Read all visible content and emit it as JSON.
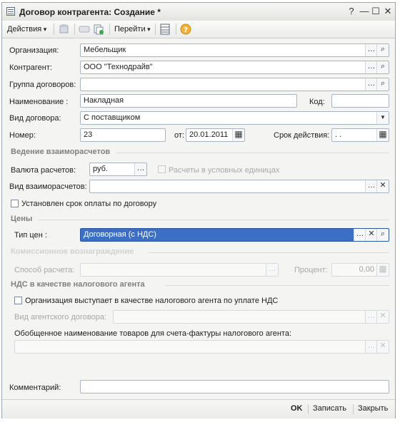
{
  "window": {
    "title": "Договор контрагента: Создание *"
  },
  "toolbar": {
    "actions_label": "Действия",
    "goto_label": "Перейти",
    "help_glyph": "?"
  },
  "form": {
    "organization": {
      "label": "Организация:",
      "value": "Мебельщик"
    },
    "counterparty": {
      "label": "Контрагент:",
      "value": "ООО \"Технодрайв\""
    },
    "contract_group": {
      "label": "Группа договоров:",
      "value": ""
    },
    "name": {
      "label": "Наименование :",
      "value": "Накладная"
    },
    "code": {
      "label": "Код:",
      "value": ""
    },
    "contract_type": {
      "label": "Вид договора:",
      "value": "С поставщиком"
    },
    "number": {
      "label": "Номер:",
      "value": "23"
    },
    "date": {
      "label": "от:",
      "value": "20.01.2011"
    },
    "validity": {
      "label": "Срок действия:",
      "value": " .  . "
    }
  },
  "settlements": {
    "header": "Ведение взаиморасчетов",
    "currency": {
      "label": "Валюта расчетов:",
      "value": "руб."
    },
    "conventional_units": {
      "label": "Расчеты в условных единицах",
      "checked": false
    },
    "settlement_type": {
      "label": "Вид взаиморасчетов:",
      "value": ""
    },
    "payment_term": {
      "label": "Установлен срок оплаты по договору",
      "checked": false
    }
  },
  "prices": {
    "header": "Цены",
    "price_type": {
      "label": "Тип цен :",
      "value": "Договорная (с НДС)"
    }
  },
  "commission": {
    "header": "Комиссионное вознаграждение",
    "method": {
      "label": "Способ расчета:",
      "value": ""
    },
    "percent": {
      "label": "Процент:",
      "value": "0,00"
    }
  },
  "vat_agent": {
    "header": "НДС в качестве налогового агента",
    "acts_as_agent": {
      "label": "Организация выступает в качестве налогового агента по уплате НДС",
      "checked": false
    },
    "agent_contract_type": {
      "label": "Вид агентского договора:",
      "value": ""
    },
    "goods_name": {
      "label": "Обобщенное наименование товаров для счета-фактуры налогового агента:",
      "value": ""
    }
  },
  "comment": {
    "label": "Комментарий:",
    "value": ""
  },
  "footer": {
    "ok": "OK",
    "save": "Записать",
    "close": "Закрыть"
  },
  "icons": {
    "choose": "…",
    "search": "🔍",
    "clear": "✕",
    "dropdown": "▼",
    "calendar": "▦"
  }
}
